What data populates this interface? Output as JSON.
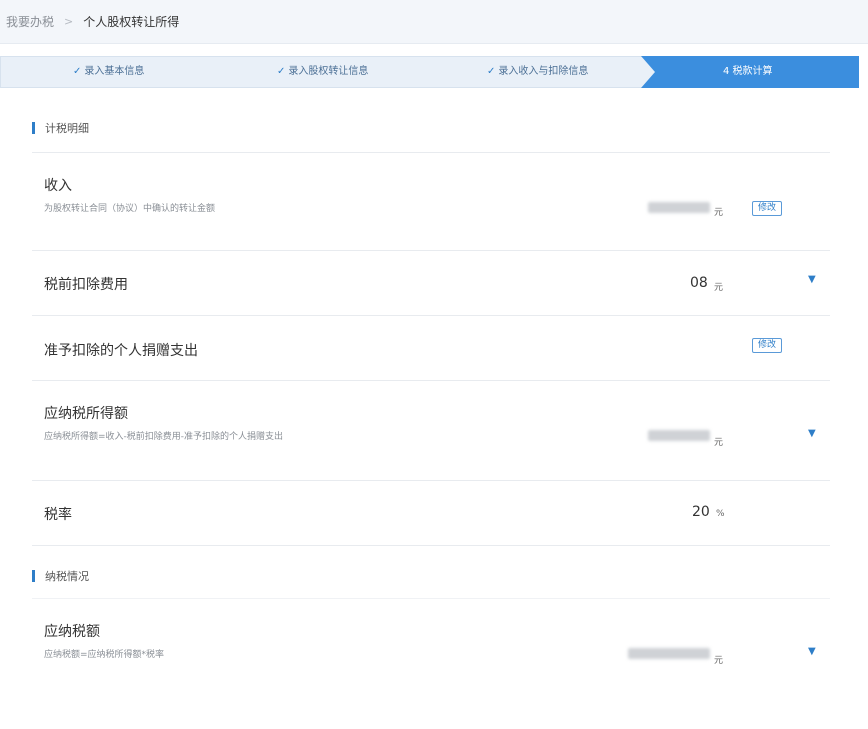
{
  "breadcrumb": {
    "root": "我要办税",
    "current": "个人股权转让所得"
  },
  "steps": [
    {
      "label": "录入基本信息"
    },
    {
      "label": "录入股权转让信息"
    },
    {
      "label": "录入收入与扣除信息"
    },
    {
      "label": "4  税款计算"
    }
  ],
  "sections": {
    "calc_detail": "计税明细",
    "tax_status": "纳税情况"
  },
  "rows": {
    "income": {
      "title": "收入",
      "subtitle": "为股权转让合同（协议）中确认的转让金额",
      "unit": "元",
      "edit": "修改"
    },
    "pretax_deduction": {
      "title": "税前扣除费用",
      "value": "08",
      "unit": "元"
    },
    "donation": {
      "title": "准予扣除的个人捐赠支出",
      "edit": "修改"
    },
    "taxable_income": {
      "title": "应纳税所得额",
      "subtitle": "应纳税所得额=收入-税前扣除费用-准予扣除的个人捐赠支出",
      "unit": "元"
    },
    "tax_rate": {
      "title": "税率",
      "value": "20",
      "unit": "%"
    },
    "tax_payable": {
      "title": "应纳税额",
      "subtitle": "应纳税额=应纳税所得额*税率",
      "unit": "元"
    }
  },
  "icons": {
    "check": "check-icon",
    "expand": "chevron-down-icon",
    "separator": "chevron-right-icon"
  },
  "colors": {
    "accent": "#3b8ede",
    "step_bg": "#e9f0f8"
  }
}
